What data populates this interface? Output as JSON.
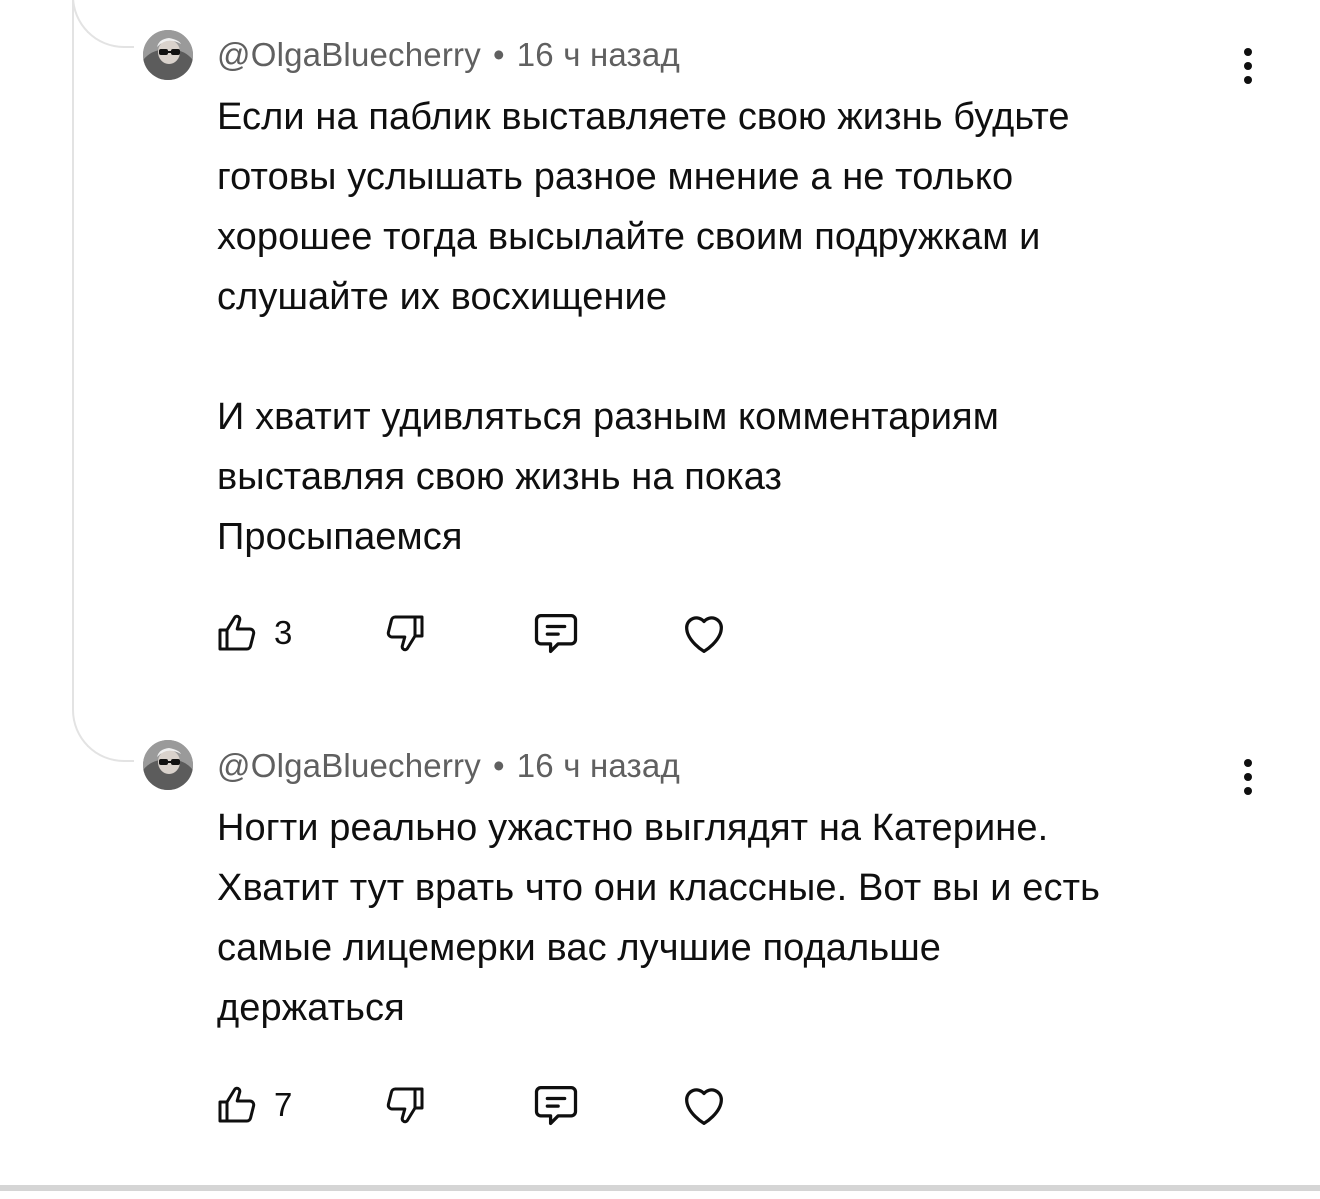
{
  "comments": [
    {
      "author": "@OlgaBluecherry",
      "separator": "•",
      "time": "16 ч назад",
      "text": "Если на паблик выставляете свою жизнь будьте\nготовы услышать разное мнение а не только\nхорошее тогда высылайте своим подружкам и\nслушайте их восхищение\n\nИ хватит удивляться разным комментариям\nвыставляя свою жизнь на показ\nПросыпаемся",
      "likes": "3",
      "icons": {
        "like": "thumbs-up-icon",
        "dislike": "thumbs-down-icon",
        "reply": "comment-icon",
        "heart": "heart-icon",
        "more": "kebab-menu-icon"
      }
    },
    {
      "author": "@OlgaBluecherry",
      "separator": "•",
      "time": "16 ч назад",
      "text": "Ногти реально ужастно выглядят на Катерине.\nХватит тут врать что они классные. Вот вы и есть\nсамые лицемерки вас лучшие подальше\nдержаться",
      "likes": "7",
      "icons": {
        "like": "thumbs-up-icon",
        "dislike": "thumbs-down-icon",
        "reply": "comment-icon",
        "heart": "heart-icon",
        "more": "kebab-menu-icon"
      }
    }
  ],
  "colors": {
    "text": "#0f0f0f",
    "meta": "#606060",
    "thread_line": "#e3e3e3"
  }
}
